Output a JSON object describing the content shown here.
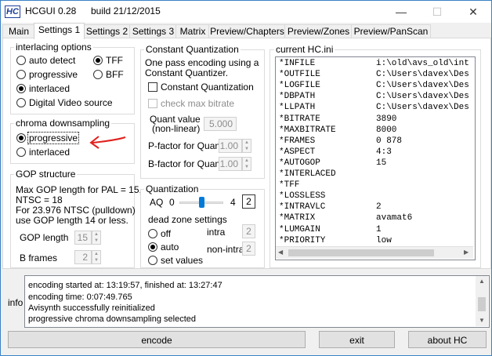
{
  "window": {
    "app_title": "HCGUI 0.28",
    "build": "build 21/12/2015",
    "icon_text": "HC",
    "minimize": "—",
    "maximize": "☐",
    "close": "✕"
  },
  "tabs": [
    "Main",
    "Settings 1",
    "Settings 2",
    "Settings 3",
    "Matrix",
    "Preview/Chapters",
    "Preview/Zones",
    "Preview/PanScan"
  ],
  "interlacing": {
    "title": "interlacing options",
    "auto_detect": "auto detect",
    "progressive": "progressive",
    "interlaced": "interlaced",
    "digital_video_source": "Digital Video source",
    "tff": "TFF",
    "bff": "BFF"
  },
  "chroma": {
    "title": "chroma downsampling",
    "progressive": "progressive",
    "interlaced": "interlaced"
  },
  "gop": {
    "title": "GOP structure",
    "info_lines": [
      "Max GOP length for PAL = 15,",
      "NTSC = 18",
      "For 23.976 NTSC (pulldown)",
      "use GOP length 14 or less."
    ],
    "gop_length_label": "GOP length",
    "gop_length_value": "15",
    "b_frames_label": "B frames",
    "b_frames_value": "2"
  },
  "cq": {
    "title": "Constant Quantization",
    "desc_lines": [
      "One pass encoding using a",
      "Constant Quantizer."
    ],
    "constant_quantization": "Constant Quantization",
    "check_max_bitrate": "check max bitrate",
    "quant_value_label": "Quant value",
    "quant_value_sub": "(non-linear)",
    "quant_value": "5.000",
    "pfactor_label": "P-factor for Quant",
    "pfactor_value": "1.00",
    "bfactor_label": "B-factor for Quant",
    "bfactor_value": "1.00"
  },
  "quantization": {
    "title": "Quantization",
    "aq_label": "AQ",
    "aq_min": "0",
    "aq_max": "4",
    "aq_value": "2",
    "aq_slider_fraction": 0.5,
    "dead_zone_title": "dead zone settings",
    "off": "off",
    "auto": "auto",
    "set_values": "set values",
    "intra_label": "intra",
    "intra_value": "2",
    "nonintra_label": "non-intra",
    "nonintra_value": "2"
  },
  "ini": {
    "title": "current HC.ini",
    "rows": [
      {
        "key": "*INFILE",
        "value": "i:\\old\\avs_old\\int"
      },
      {
        "key": "*OUTFILE",
        "value": "C:\\Users\\davex\\Des"
      },
      {
        "key": "*LOGFILE",
        "value": "C:\\Users\\davex\\Des"
      },
      {
        "key": "*DBPATH",
        "value": "C:\\Users\\davex\\Des"
      },
      {
        "key": "*LLPATH",
        "value": "C:\\Users\\davex\\Des"
      },
      {
        "key": "*BITRATE",
        "value": "3890"
      },
      {
        "key": "*MAXBITRATE",
        "value": "8000"
      },
      {
        "key": "*FRAMES",
        "value": "0 878"
      },
      {
        "key": "*ASPECT",
        "value": "4:3"
      },
      {
        "key": "*AUTOGOP",
        "value": "15"
      },
      {
        "key": "*INTERLACED",
        "value": ""
      },
      {
        "key": "*TFF",
        "value": ""
      },
      {
        "key": "*LOSSLESS",
        "value": ""
      },
      {
        "key": "*INTRAVLC",
        "value": "2"
      },
      {
        "key": "*MATRIX",
        "value": "avamat6"
      },
      {
        "key": "*LUMGAIN",
        "value": "1"
      },
      {
        "key": "*PRIORITY",
        "value": "low"
      }
    ]
  },
  "info": {
    "label": "info",
    "lines": [
      "encoding started at: 13:19:57,  finished at: 13:27:47",
      "encoding time:  0:07:49.765",
      "Avisynth successfully reinitialized",
      "progressive chroma downsampling selected"
    ]
  },
  "buttons": {
    "encode": "encode",
    "exit": "exit",
    "about": "about HC"
  },
  "colors": {
    "annotation_arrow": "#e0201c",
    "window_border": "#3a82c4"
  }
}
